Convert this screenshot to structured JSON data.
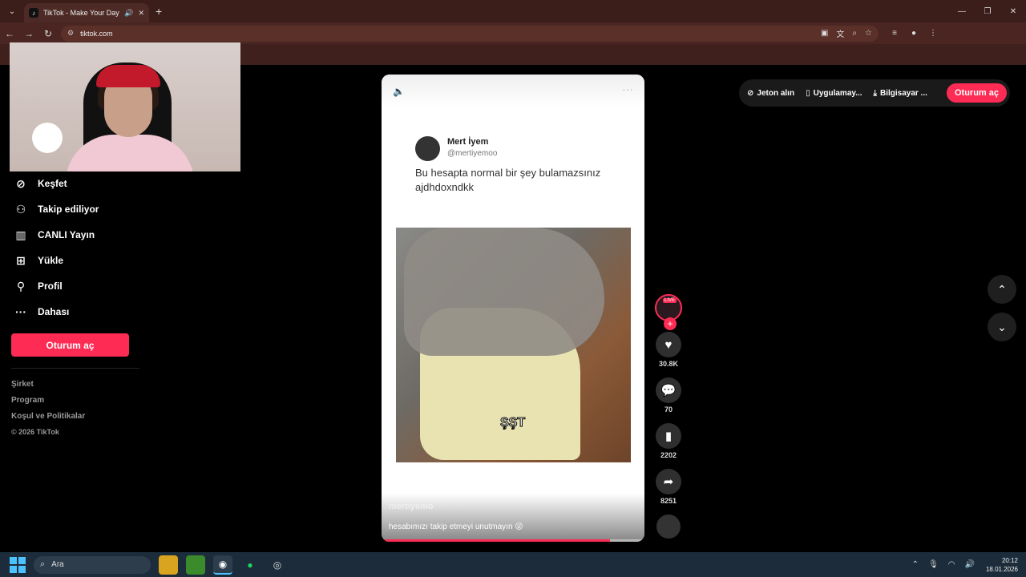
{
  "browser": {
    "tab_title": "TikTok - Make Your Day",
    "url": "tiktok.com"
  },
  "sidebar": {
    "items": [
      {
        "label": "Keşfet",
        "icon": "compass-icon"
      },
      {
        "label": "Takip ediliyor",
        "icon": "user-follow-icon"
      },
      {
        "label": "CANLI Yayın",
        "icon": "live-tv-icon"
      },
      {
        "label": "Yükle",
        "icon": "upload-plus-icon"
      },
      {
        "label": "Profil",
        "icon": "profile-icon"
      },
      {
        "label": "Dahası",
        "icon": "more-dots-icon"
      }
    ],
    "login_label": "Oturum aç",
    "links": [
      "Şirket",
      "Program",
      "Koşul ve Politikalar"
    ],
    "copyright": "© 2026 TikTok"
  },
  "video": {
    "tweet_name": "Mert İyem",
    "tweet_handle": "@mertiyemoo",
    "tweet_text": "Bu hesapta normal bir şey bulamazsınız ajdhdoxndkk",
    "overlay_text": "ŞŞT",
    "author": "mertiyemo",
    "caption": "hesabımızı takip etmeyi unutmayın 😜",
    "progress": 0.87
  },
  "actions": {
    "live_badge": "LIVE",
    "likes": "30.8K",
    "comments": "70",
    "saves": "2202",
    "shares": "8251"
  },
  "top_right": {
    "coins": "Jeton alın",
    "app": "Uygulamay...",
    "desktop": "Bilgisayar ...",
    "login": "Oturum aç"
  },
  "taskbar": {
    "search_label": "Ara",
    "time": "20:12",
    "date": "18.01.2026"
  },
  "colors": {
    "accent": "#fe2c55",
    "browser_frame": "#3b1d1a"
  }
}
